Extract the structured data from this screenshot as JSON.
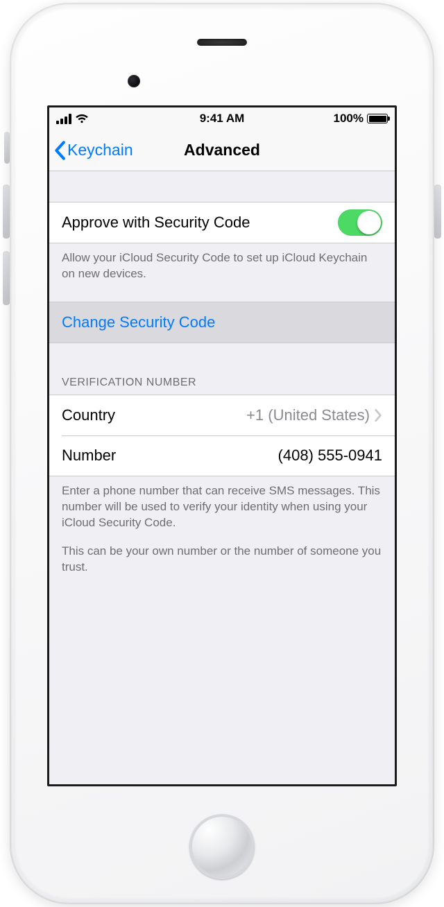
{
  "status": {
    "time": "9:41 AM",
    "battery_pct": "100%"
  },
  "nav": {
    "back_label": "Keychain",
    "title": "Advanced"
  },
  "approve": {
    "label": "Approve with Security Code",
    "footer": "Allow your iCloud Security Code to set up iCloud Keychain on new devices."
  },
  "change_code": {
    "label": "Change Security Code"
  },
  "verification": {
    "header": "VERIFICATION NUMBER",
    "country_label": "Country",
    "country_value": "+1 (United States)",
    "number_label": "Number",
    "number_value": "(408) 555-0941",
    "footer_p1": "Enter a phone number that can receive SMS messages. This number will be used to verify your identity when using your iCloud Security Code.",
    "footer_p2": "This can be your own number or the number of someone you trust."
  }
}
